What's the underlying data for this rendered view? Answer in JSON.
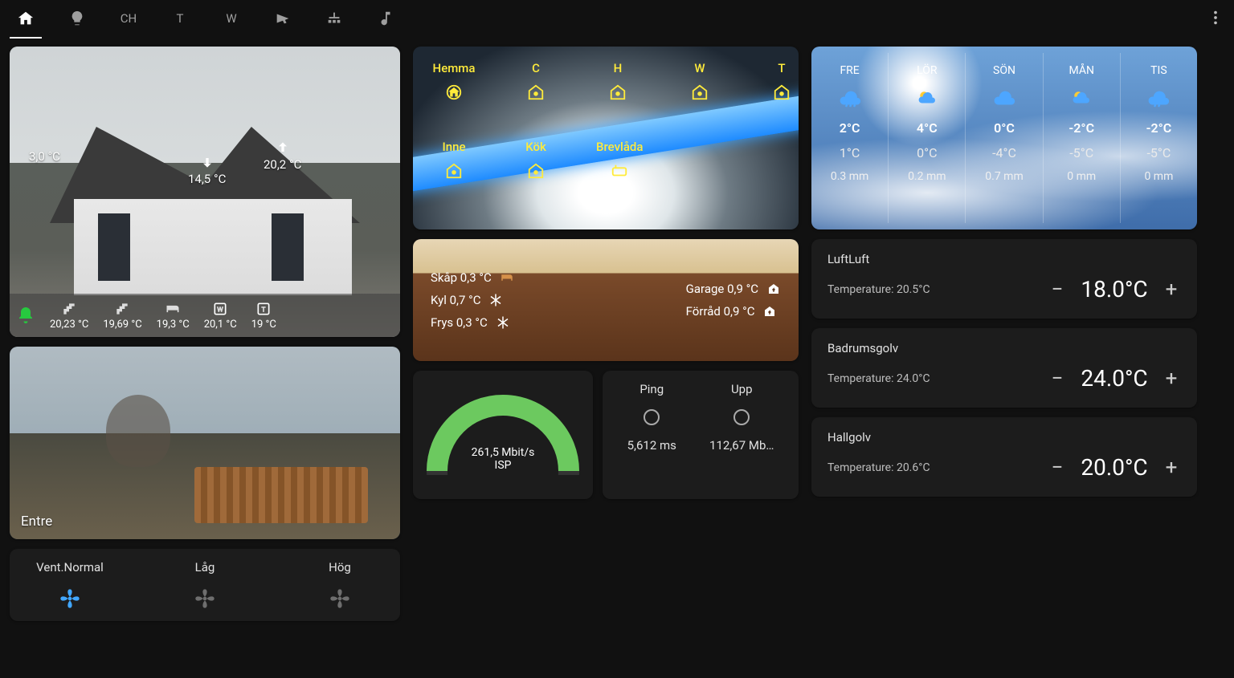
{
  "topbar": {
    "tabs": [
      {
        "name": "home"
      },
      {
        "name": "light"
      },
      {
        "label": "CH"
      },
      {
        "label": "T"
      },
      {
        "label": "W"
      },
      {
        "name": "camera"
      },
      {
        "name": "network"
      },
      {
        "name": "music"
      }
    ]
  },
  "house": {
    "outside_temp": "3,0 °C",
    "exhaust": {
      "dir": "down",
      "temp": "14,5 °C"
    },
    "supply": {
      "dir": "up",
      "temp": "20,2 °C"
    },
    "floors": [
      {
        "icon": "stairs",
        "temp": "20,23 °C"
      },
      {
        "icon": "stairs",
        "temp": "19,69 °C"
      },
      {
        "icon": "bed",
        "temp": "19,3 °C"
      },
      {
        "icon": "w",
        "temp": "20,1 °C"
      },
      {
        "icon": "t",
        "temp": "19 °C"
      }
    ]
  },
  "entre": {
    "label": "Entre"
  },
  "vent": {
    "items": [
      {
        "label": "Vent.Normal",
        "active": true
      },
      {
        "label": "Låg",
        "active": false
      },
      {
        "label": "Hög",
        "active": false
      }
    ]
  },
  "presence": {
    "rows": [
      [
        {
          "label": "Hemma",
          "icon": "home",
          "selected": true
        },
        {
          "label": "C",
          "icon": "home",
          "selected": false
        },
        {
          "label": "H",
          "icon": "home",
          "selected": false
        },
        {
          "label": "W",
          "icon": "home",
          "selected": false
        },
        {
          "label": "T",
          "icon": "home",
          "selected": false
        }
      ],
      [
        {
          "label": "Inne",
          "icon": "home",
          "selected": false
        },
        {
          "label": "Kök",
          "icon": "home",
          "selected": false
        },
        {
          "label": "Brevlåda",
          "icon": "mailbox",
          "selected": false
        }
      ]
    ]
  },
  "fridge": {
    "left": [
      {
        "label": "Skåp 0,3 °C",
        "icon": "bed"
      },
      {
        "label": "Kyl 0,7 °C",
        "icon": "snow"
      },
      {
        "label": "Frys 0,3 °C",
        "icon": "snow"
      }
    ],
    "right": [
      {
        "label": "Garage 0,9 °C",
        "icon": "house-up"
      },
      {
        "label": "Förråd 0,9 °C",
        "icon": "house-up"
      }
    ]
  },
  "isp": {
    "speed": "261,5 Mbit/s",
    "label": "ISP"
  },
  "net": {
    "ping": {
      "label": "Ping",
      "value": "5,612 ms"
    },
    "up": {
      "label": "Upp",
      "value": "112,67 Mb…"
    }
  },
  "weather": [
    {
      "day": "FRE",
      "icon": "rain",
      "hi": "2°C",
      "lo": "1°C",
      "prec": "0.3 mm"
    },
    {
      "day": "LÖR",
      "icon": "partly",
      "hi": "4°C",
      "lo": "0°C",
      "prec": "0.2 mm"
    },
    {
      "day": "SÖN",
      "icon": "cloud",
      "hi": "0°C",
      "lo": "-4°C",
      "prec": "0.7 mm"
    },
    {
      "day": "MÅN",
      "icon": "sunrain",
      "hi": "-2°C",
      "lo": "-5°C",
      "prec": "0 mm"
    },
    {
      "day": "TIS",
      "icon": "rain",
      "hi": "-2°C",
      "lo": "-5°C",
      "prec": "0 mm"
    }
  ],
  "thermostats": [
    {
      "name": "LuftLuft",
      "current": "Temperature: 20.5°C",
      "set": "18.0°C"
    },
    {
      "name": "Badrumsgolv",
      "current": "Temperature: 24.0°C",
      "set": "24.0°C"
    },
    {
      "name": "Hallgolv",
      "current": "Temperature: 20.6°C",
      "set": "20.0°C"
    }
  ],
  "chart_data": {
    "type": "gauge",
    "title": "ISP",
    "value": 261.5,
    "unit": "Mbit/s",
    "range": [
      0,
      300
    ],
    "fill_color": "#6cc95f"
  }
}
